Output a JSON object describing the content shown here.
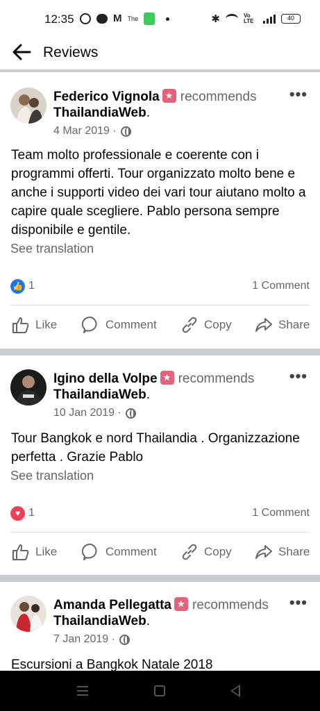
{
  "status_bar": {
    "time": "12:35",
    "battery": "40",
    "volte": "Vo LTE"
  },
  "header": {
    "title": "Reviews"
  },
  "labels": {
    "recommends": "recommends",
    "see_translation": "See translation",
    "like": "Like",
    "comment": "Comment",
    "copy": "Copy",
    "share": "Share"
  },
  "posts": [
    {
      "author": "Federico Vignola",
      "page": "ThailandiaWeb",
      "date": "4 Mar 2019 ·",
      "text": "Team molto professionale e coerente con i programmi offerti. Tour organizzato molto bene e anche i supporti video dei vari tour aiutano molto a capire quale scegliere. Pablo persona sempre disponibile e gentile.",
      "reaction": "like",
      "reaction_count": "1",
      "comments": "1 Comment"
    },
    {
      "author": "Igino della Volpe",
      "page": "ThailandiaWeb",
      "date": "10 Jan 2019 ·",
      "text": "Tour Bangkok e nord Thailandia . Organizzazione perfetta . Grazie Pablo",
      "reaction": "love",
      "reaction_count": "1",
      "comments": "1 Comment"
    },
    {
      "author": "Amanda Pellegatta",
      "page": "ThailandiaWeb",
      "date": "7 Jan 2019 ·",
      "text": "Escursioni a Bangkok Natale 2018"
    }
  ],
  "colors": {
    "recommend_badge": "#e4637b",
    "like_blue": "#1877f2",
    "love_red": "#f33e58",
    "secondary_text": "#65676b"
  }
}
